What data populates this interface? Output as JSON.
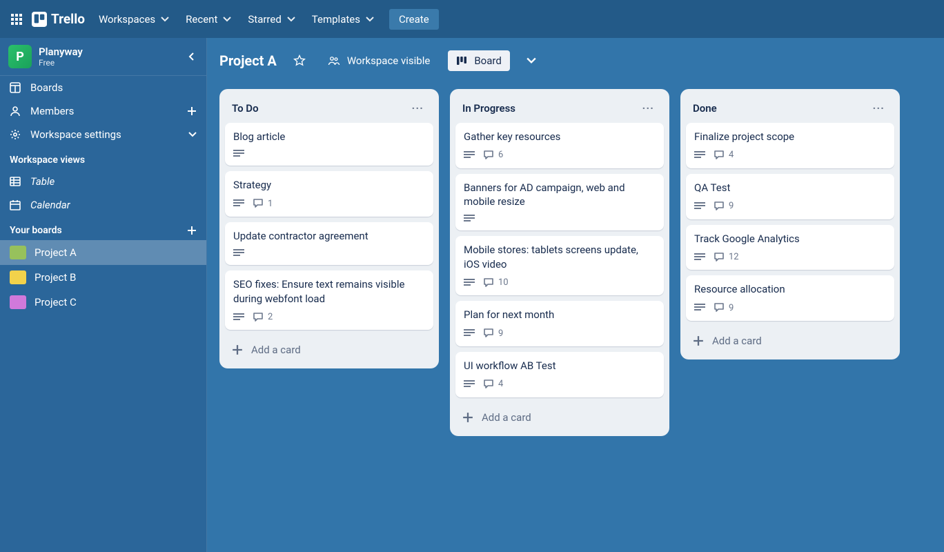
{
  "nav": {
    "workspaces": "Workspaces",
    "recent": "Recent",
    "starred": "Starred",
    "templates": "Templates",
    "create": "Create",
    "brand": "Trello"
  },
  "sidebar": {
    "workspace_name": "Planyway",
    "workspace_plan": "Free",
    "boards": "Boards",
    "members": "Members",
    "settings": "Workspace settings",
    "views_title": "Workspace views",
    "table": "Table",
    "calendar": "Calendar",
    "your_boards": "Your boards",
    "user_boards": [
      {
        "name": "Project A",
        "color": "#97c15c",
        "active": true
      },
      {
        "name": "Project B",
        "color": "#f2d24b",
        "active": false
      },
      {
        "name": "Project C",
        "color": "#d079db",
        "active": false
      }
    ]
  },
  "header": {
    "board_title": "Project A",
    "workspace_visible": "Workspace visible",
    "board_btn": "Board"
  },
  "lists": [
    {
      "title": "To Do",
      "cards": [
        {
          "title": "Blog article",
          "has_desc": true
        },
        {
          "title": "Strategy",
          "has_desc": true,
          "comments": 1
        },
        {
          "title": "Update contractor agreement",
          "has_desc": true
        },
        {
          "title": "SEO fixes: Ensure text remains visible during webfont load",
          "has_desc": true,
          "comments": 2
        }
      ]
    },
    {
      "title": "In Progress",
      "cards": [
        {
          "title": "Gather key resources",
          "has_desc": true,
          "comments": 6
        },
        {
          "title": "Banners for AD campaign, web and mobile resize",
          "has_desc": true
        },
        {
          "title": "Mobile stores: tablets screens update, iOS video",
          "has_desc": true,
          "comments": 10
        },
        {
          "title": "Plan for next month",
          "has_desc": true,
          "comments": 9
        },
        {
          "title": "UI workflow AB Test",
          "has_desc": true,
          "comments": 4
        }
      ]
    },
    {
      "title": "Done",
      "cards": [
        {
          "title": "Finalize project scope",
          "has_desc": true,
          "comments": 4
        },
        {
          "title": "QA Test",
          "has_desc": true,
          "comments": 9
        },
        {
          "title": "Track Google Analytics",
          "has_desc": true,
          "comments": 12
        },
        {
          "title": "Resource allocation",
          "has_desc": true,
          "comments": 9
        }
      ]
    }
  ],
  "add_card": "Add a card"
}
